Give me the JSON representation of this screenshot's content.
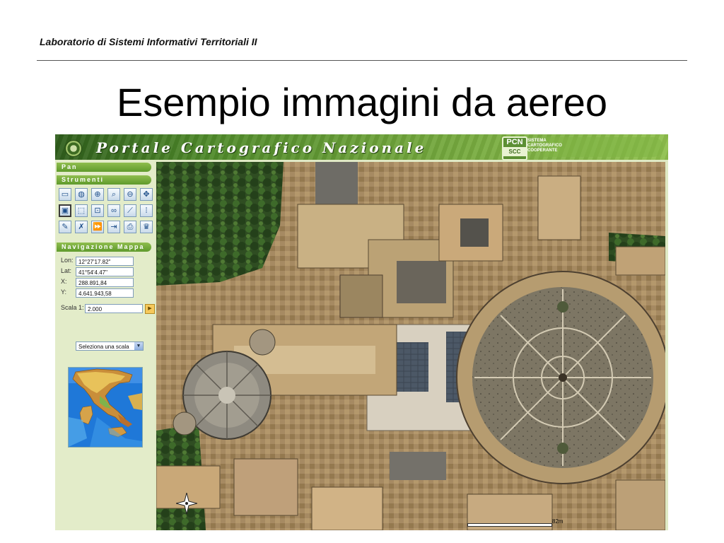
{
  "slide": {
    "header": "Laboratorio di Sistemi Informativi Territoriali II",
    "title": "Esempio immagini da aereo"
  },
  "portal": {
    "banner_title": "Portale Cartografico Nazionale",
    "logo_text": "PCN",
    "logo_subtext": "SCC",
    "tagline": "SISTEMA CARTOGRAFICO COOPERANTE"
  },
  "sidebar": {
    "sections": {
      "pan": "Pan",
      "strumenti": "Strumenti",
      "navigazione": "Navigazione Mappa"
    },
    "tools": [
      {
        "icon": "window-icon",
        "glyph": "▭"
      },
      {
        "icon": "globe-icon",
        "glyph": "◍"
      },
      {
        "icon": "zoom-in-icon",
        "glyph": "⊕"
      },
      {
        "icon": "zoom-icon",
        "glyph": "⌕"
      },
      {
        "icon": "zoom-out-icon",
        "glyph": "⊖"
      },
      {
        "icon": "full-extent-icon",
        "glyph": "✥"
      },
      {
        "icon": "identify-icon",
        "glyph": "▣"
      },
      {
        "icon": "select-icon",
        "glyph": "⬚"
      },
      {
        "icon": "zoom-window-icon",
        "glyph": "⊡"
      },
      {
        "icon": "binoculars-icon",
        "glyph": "∞"
      },
      {
        "icon": "measure-icon",
        "glyph": "⟋"
      },
      {
        "icon": "layers-icon",
        "glyph": "⁞"
      },
      {
        "icon": "eraser-icon",
        "glyph": "✎"
      },
      {
        "icon": "redline-icon",
        "glyph": "✗"
      },
      {
        "icon": "forward-icon",
        "glyph": "⏩"
      },
      {
        "icon": "export-icon",
        "glyph": "⇥"
      },
      {
        "icon": "print-icon",
        "glyph": "⎙"
      },
      {
        "icon": "crown-icon",
        "glyph": "♛"
      }
    ],
    "navigation": {
      "lon_label": "Lon:",
      "lon_value": "12°27'17.82\"",
      "lat_label": "Lat:",
      "lat_value": "41°54'4.47\"",
      "x_label": "X:",
      "x_value": "288.891,84",
      "y_label": "Y:",
      "y_value": "4.641.943,58",
      "scala_label": "Scala 1:",
      "scala_value": "2.000",
      "scale_select": "Seleziona una scala"
    }
  },
  "map": {
    "scale_label": "82m"
  }
}
